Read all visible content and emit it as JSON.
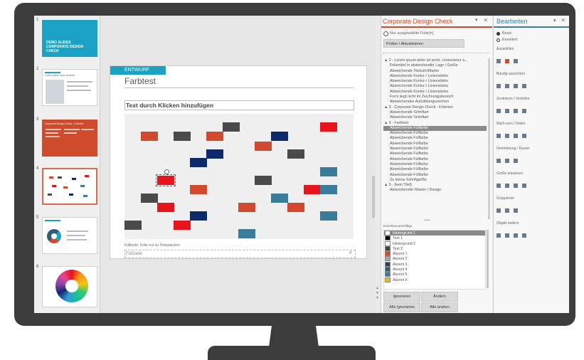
{
  "thumbnails": [
    {
      "num": "1",
      "title": "DEMO SLIDES CORPORATE DESIGN CHECK",
      "color": "#1aa1c3"
    },
    {
      "num": "2",
      "caption": "Lorem ipsum dolor sit amet"
    },
    {
      "num": "3",
      "title": "Corporate Design Check - Kriterien",
      "color": "#d04b2c"
    },
    {
      "num": "4"
    },
    {
      "num": "5"
    },
    {
      "num": "6"
    }
  ],
  "slide": {
    "tag": "ENTWURF",
    "title": "Farbtest",
    "placeholder": "Text durch Klicken hinzufügen",
    "note": "Füllmoto: Folie nur zu Testzwecken",
    "footer": "Fußzeile",
    "page": "4"
  },
  "cdc": {
    "title": "Corporate Design Check",
    "pin": "▾",
    "close": "×",
    "checkbox_label": "Nur ausgewählte Folie(n)",
    "check_button": "Prüfen / Aktualisieren",
    "tree": [
      {
        "label": "▲ 2 - Lorem ipsum dolor sit amet, consectetur a...",
        "indent": 0
      },
      {
        "label": "Folientitel in abweichender Lage / Größe",
        "indent": 1
      },
      {
        "label": "Abweichende Titelschriftfarbe",
        "indent": 1
      },
      {
        "label": "Abweichende Kontur-/ Linienstärke",
        "indent": 1
      },
      {
        "label": "Abweichende Kontur-/ Linienstärke",
        "indent": 1
      },
      {
        "label": "Abweichende Kontur-/ Linienstärke",
        "indent": 1
      },
      {
        "label": "Abweichende Kontur-/ Linienstärke",
        "indent": 1
      },
      {
        "label": "Form liegt nicht im Zeichnungsbereich",
        "indent": 1
      },
      {
        "label": "Abweichendes Aufzählungszeichen",
        "indent": 1
      },
      {
        "label": "▲ 3 - Corporate Design Check - Kriterien",
        "indent": 0
      },
      {
        "label": "Abweichende Schriftart",
        "indent": 1
      },
      {
        "label": "Abweichende Schriftart",
        "indent": 1
      },
      {
        "label": "▲ 4 - Farbtest",
        "indent": 0
      },
      {
        "label": "Abweichende Füllfarbe",
        "indent": 1,
        "selected": true
      },
      {
        "label": "Abweichende Füllfarbe",
        "indent": 1
      },
      {
        "label": "Abweichende Füllfarbe",
        "indent": 1
      },
      {
        "label": "Abweichende Füllfarbe",
        "indent": 1
      },
      {
        "label": "Abweichende Füllfarbe",
        "indent": 1
      },
      {
        "label": "Abweichende Füllfarbe",
        "indent": 1
      },
      {
        "label": "Abweichende Füllfarbe",
        "indent": 1
      },
      {
        "label": "Abweichende Füllfarbe",
        "indent": 1
      },
      {
        "label": "Abweichende Füllfarbe",
        "indent": 1
      },
      {
        "label": "Abweichende Füllfarbe",
        "indent": 1
      },
      {
        "label": "Zu kleine Schriftgröße",
        "indent": 1
      },
      {
        "label": "▲ 5 - (kein Titel)",
        "indent": 0
      },
      {
        "label": "Abweichender Master / Design",
        "indent": 1
      }
    ],
    "suggest_label": "Korrekturvorschläge",
    "colors": [
      {
        "label": "Hintergrund 1",
        "hex": "#ffffff",
        "selected": true
      },
      {
        "label": "Text 1",
        "hex": "#000000"
      },
      {
        "label": "Hintergrund 2",
        "hex": "#ffffff"
      },
      {
        "label": "Text 2",
        "hex": "#444444"
      },
      {
        "label": "Akzent 1",
        "hex": "#d24a2d"
      },
      {
        "label": "Akzent 2",
        "hex": "#a5a5a5"
      },
      {
        "label": "Akzent 3",
        "hex": "#333f48"
      },
      {
        "label": "Akzent 4",
        "hex": "#2e5d7a"
      },
      {
        "label": "Akzent 5",
        "hex": "#3f7da0"
      },
      {
        "label": "Akzent 6",
        "hex": "#f0c000"
      }
    ],
    "buttons": {
      "ignore": "Ignorieren",
      "change": "Ändern",
      "ignore_all": "Alle Ignorieren",
      "change_all": "Alle ändern"
    }
  },
  "edit": {
    "title": "Bearbeiten",
    "close": "×",
    "mode_basic": "Basic",
    "mode_ext": "Erweitert",
    "sections": [
      "Auswählen",
      "Bündig ausrichten",
      "Zentrieren / Verteilen",
      "Nach vorn / hinten",
      "Orientierung / Raster",
      "Größe anpassen",
      "Gruppieren",
      "Objekt ändern"
    ]
  },
  "colors": {
    "accent": "#d24a2d",
    "blue": "#1aa1c3",
    "navy": "#0f2a6b",
    "grey": "#4a4a4a",
    "red": "#e8141b",
    "teal": "#3b7c9a"
  }
}
